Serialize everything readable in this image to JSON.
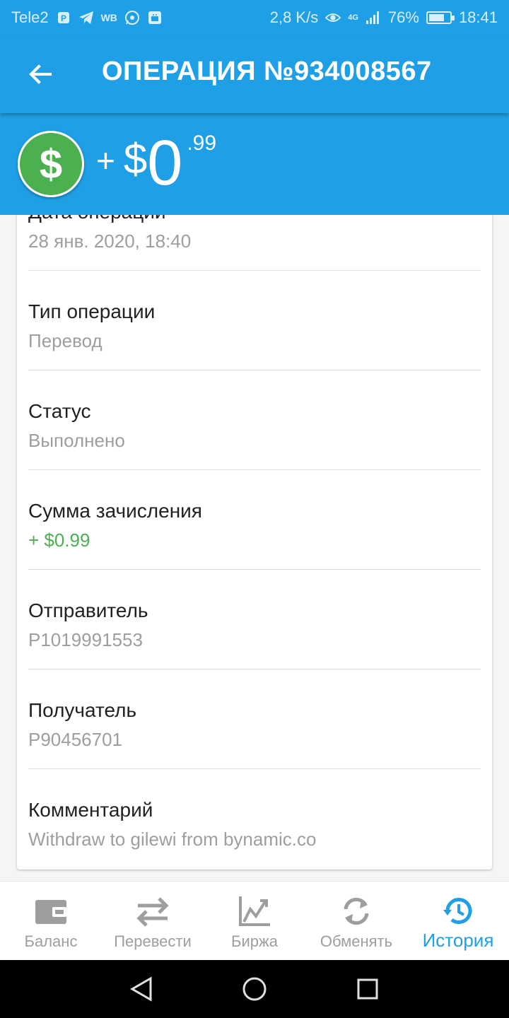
{
  "status_bar": {
    "carrier": "Tele2",
    "speed": "2,8 K/s",
    "network": "4G",
    "battery": "76%",
    "battery_level": 0.76,
    "time": "18:41",
    "notification_icons": [
      "parking-p-icon",
      "telegram-icon",
      "wb-icon",
      "whatsapp-icon",
      "android-icon"
    ],
    "wb_text": "WB",
    "p_text": "P"
  },
  "app_bar": {
    "title": "ОПЕРАЦИЯ №934008567",
    "back_icon": "arrow-left-icon"
  },
  "amount": {
    "sign": "+",
    "currency": "$",
    "integer": "0",
    "fraction": ".99",
    "coin_symbol": "$",
    "coin_color": "#4caf50"
  },
  "details": [
    {
      "label": "Дата операции",
      "value": "28 янв. 2020, 18:40"
    },
    {
      "label": "Тип операции",
      "value": "Перевод"
    },
    {
      "label": "Статус",
      "value": "Выполнено"
    },
    {
      "label": "Сумма зачисления",
      "value": "+ $0.99",
      "color": "#4caf50"
    },
    {
      "label": "Отправитель",
      "value": "P1019991553"
    },
    {
      "label": "Получатель",
      "value": "P90456701"
    },
    {
      "label": "Комментарий",
      "value": "Withdraw to gilewi from bynamic.co"
    }
  ],
  "bottom_nav": [
    {
      "label": "Баланс",
      "icon": "wallet-icon",
      "active": false
    },
    {
      "label": "Перевести",
      "icon": "transfer-arrows-icon",
      "active": false
    },
    {
      "label": "Биржа",
      "icon": "chart-trend-icon",
      "active": false
    },
    {
      "label": "Обменять",
      "icon": "exchange-refresh-icon",
      "active": false
    },
    {
      "label": "История",
      "icon": "history-clock-icon",
      "active": true
    }
  ],
  "colors": {
    "primary": "#1fa0e6",
    "accent_green": "#4caf50",
    "muted_text": "#9e9e9e"
  },
  "system_nav": {
    "back": "back-triangle-icon",
    "home": "home-circle-icon",
    "recents": "recents-square-icon"
  }
}
